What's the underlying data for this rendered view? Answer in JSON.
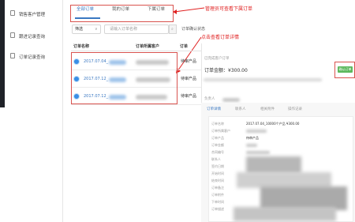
{
  "sidebar": {
    "items": [
      {
        "label": "销售客户管理"
      },
      {
        "label": "跟进记录查询"
      },
      {
        "label": "订单记录查询"
      }
    ]
  },
  "tabs": [
    {
      "label": "全部订单"
    },
    {
      "label": "我的订单"
    },
    {
      "label": "下属订单"
    }
  ],
  "annotations": {
    "tabs_note": "管理员可查看下属订单",
    "rows_note": "点击查看订单详情"
  },
  "filter": {
    "select_label": "筛选",
    "search_placeholder": "请输入订单名称",
    "filter_label": "订单确认状态"
  },
  "table": {
    "headers": [
      "订单名称",
      "订单所属客户",
      "订单"
    ],
    "rows": [
      {
        "name": "2017.07.04_",
        "status": "待审产品"
      },
      {
        "name": "2017.07.12_",
        "status": "待审产品"
      },
      {
        "name": "2017.07.12_",
        "status": "待审产品"
      }
    ]
  },
  "detail": {
    "top_label": "已完成客户订单",
    "amount": "订单金额：¥300.00",
    "approve_label": "确认订单",
    "owner_label": "负责人",
    "tabs": [
      "订单详情",
      "联系人",
      "相关附件",
      "操作记录"
    ],
    "record_title": "2017.07.04_10000个产品 ¥300.00",
    "record_product": "待审产品",
    "fields": [
      "订单名称",
      "订单所属客户",
      "订单产品",
      "订单金额",
      "合同编号",
      "联系人",
      "签约日期",
      "开始时间",
      "结束时间",
      "订单备注",
      "订单附件",
      "下单时间",
      "订单描述"
    ]
  }
}
